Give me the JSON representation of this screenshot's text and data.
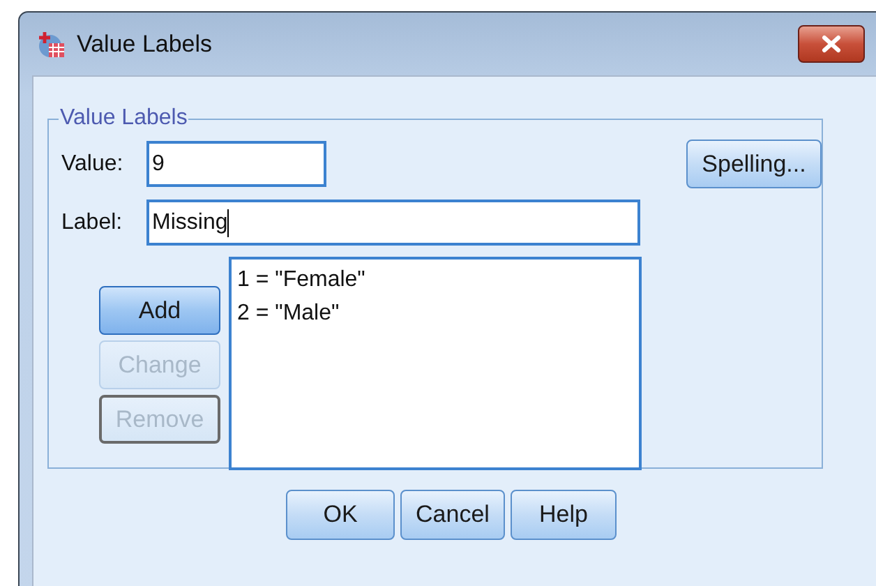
{
  "window": {
    "title": "Value Labels"
  },
  "group": {
    "title": "Value Labels"
  },
  "value_field": {
    "label": "Value:",
    "value": "9",
    "focused": false
  },
  "label_field": {
    "label": "Label:",
    "value": "Missing",
    "focused": true
  },
  "spelling_button": {
    "label": "Spelling...",
    "disabled": false
  },
  "side_buttons": [
    {
      "label": "Add",
      "disabled": false,
      "default": true,
      "focused": false
    },
    {
      "label": "Change",
      "disabled": true,
      "default": false,
      "focused": false
    },
    {
      "label": "Remove",
      "disabled": true,
      "default": false,
      "focused": true
    }
  ],
  "labels_list": [
    {
      "text": "1 = \"Female\"",
      "selected": false
    },
    {
      "text": "2 = \"Male\"",
      "selected": false
    }
  ],
  "buttons": [
    {
      "label": "OK"
    },
    {
      "label": "Cancel"
    },
    {
      "label": "Help"
    }
  ]
}
